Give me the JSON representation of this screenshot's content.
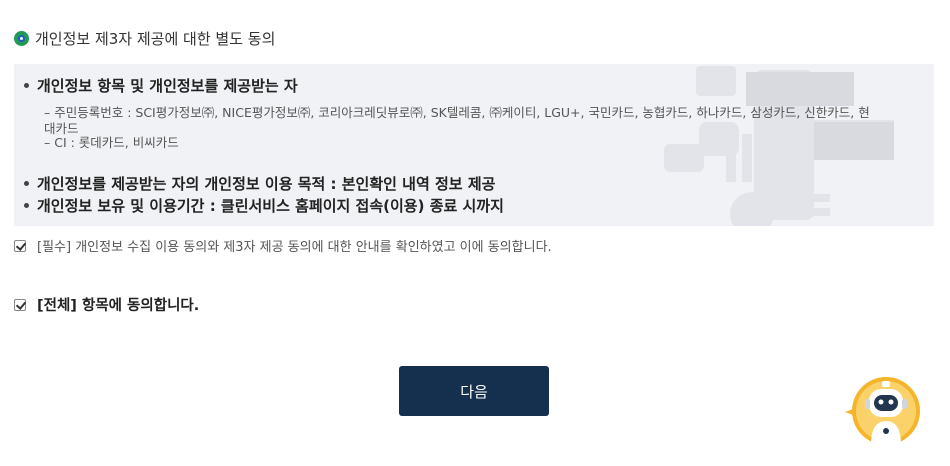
{
  "section": {
    "title": "개인정보 제3자 제공에 대한 별도 동의"
  },
  "info": {
    "recipient_title": "개인정보 항목 및 개인정보를 제공받는 자",
    "recipient_line1": "– 주민등록번호 : SCI평가정보㈜, NICE평가정보㈜, 코리아크레딧뷰로㈜, SK텔레콤, ㈜케이티, LGU+, 국민카드, 농협카드, 하나카드, 삼성카드, 신한카드, 현",
    "recipient_line1_cont": "대카드",
    "recipient_line2": "– CI : 롯데카드, 비씨카드",
    "purpose": "개인정보를 제공받는 자의 개인정보 이용 목적 : 본인확인 내역 정보 제공",
    "retention": "개인정보 보유 및 이용기간 : 클린서비스 홈페이지 접속(이용) 종료 시까지"
  },
  "consent": {
    "required_label": "[필수] 개인정보 수집 이용 동의와 제3자 제공 동의에 대한 안내를 확인하였고 이에 동의합니다.",
    "required_checked": true,
    "all_label": "[전체] 항목에 동의합니다.",
    "all_checked": true
  },
  "actions": {
    "next_label": "다음"
  },
  "colors": {
    "primary": "#15304e",
    "info_bg": "#f1f2f6",
    "chatbot_accent": "#f5b52a"
  },
  "icons": {
    "section": "radio-dot-icon",
    "chatbot": "chatbot-robot-icon"
  }
}
